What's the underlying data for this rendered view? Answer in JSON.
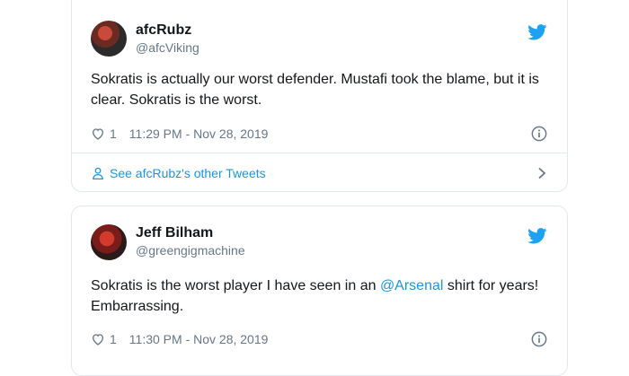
{
  "tweets": [
    {
      "display_name": "afcRubz",
      "handle": "@afcViking",
      "text": "Sokratis is actually our worst defender. Mustafi took the blame, but it is clear. Sokratis is the worst.",
      "likes": "1",
      "timestamp": "11:29 PM - Nov 28, 2019",
      "see_more": "See afcRubz's other Tweets"
    },
    {
      "display_name": "Jeff Bilham",
      "handle": "@greengigmachine",
      "text_before": "Sokratis is the worst player I have seen in an ",
      "mention": "@Arsenal",
      "text_after": " shirt for years! Embarrassing.",
      "likes": "1",
      "timestamp": "11:30 PM - Nov 28, 2019"
    }
  ],
  "colors": {
    "link": "#1b95e0",
    "secondary_text": "#657786",
    "border": "#e1e8ed",
    "twitter_blue": "#1da1f2"
  },
  "icons": [
    "twitter-bird-icon",
    "heart-icon",
    "info-icon",
    "person-icon",
    "chevron-right-icon"
  ]
}
